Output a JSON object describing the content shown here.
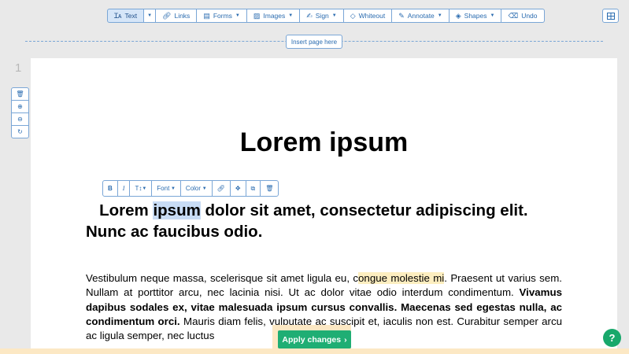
{
  "toolbar": {
    "text": "Text",
    "links": "Links",
    "forms": "Forms",
    "images": "Images",
    "sign": "Sign",
    "whiteout": "Whiteout",
    "annotate": "Annotate",
    "shapes": "Shapes",
    "undo": "Undo"
  },
  "insert_page": "Insert page here",
  "page_number": "1",
  "format_bar": {
    "bold": "B",
    "italic": "I",
    "size": "T↕",
    "font": "Font",
    "color": "Color"
  },
  "document": {
    "title": "Lorem ipsum",
    "heading_a": "Lorem ",
    "heading_sel": "ipsum",
    "heading_b": " dolor sit amet, consectetur adipiscing elit. Nunc ac faucibus odio.",
    "p_a": "Vestibulum neque massa, scelerisque sit amet ligula eu, c",
    "p_hl": "ongue molestie mi",
    "p_b": ". Praesent ut varius sem. Nullam at porttitor arcu, nec lacinia nisi. Ut ac dolor vitae odio interdum condimentum. ",
    "p_bold": "Vivamus dapibus sodales ex, vitae malesuada ipsum cursus convallis. Maecenas sed egestas nulla, ac condimentum orci.",
    "p_c": " Mauris diam felis, vulputate ac suscipit et, iaculis non est. Curabitur semper arcu ac ligula semper, nec luctus"
  },
  "apply_label": "Apply changes",
  "colors": {
    "accent": "#2b6cb0",
    "apply": "#1fae74",
    "highlight": "#fdeec0"
  }
}
